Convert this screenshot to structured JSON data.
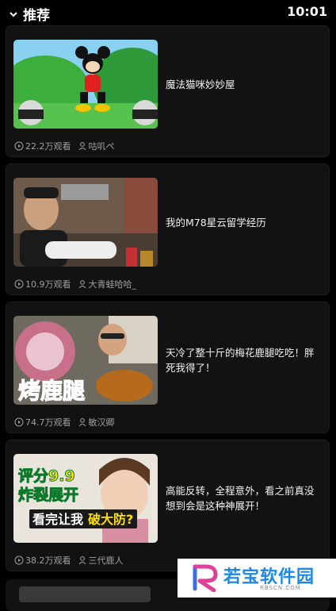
{
  "header": {
    "title": "推荐",
    "time": "10:01"
  },
  "videos": [
    {
      "title": "魔法猫咪妙妙屋",
      "views": "22.2万观看",
      "author": "咕叽ペ"
    },
    {
      "title": "我的M78星云留学经历",
      "views": "10.9万观看",
      "author": "大青蛙哈哈_"
    },
    {
      "title": "天冷了整十斤的梅花鹿腿吃吃！胖死我得了！",
      "views": "74.7万观看",
      "author": "敏汉卿",
      "thumb_text": "烤鹿腿"
    },
    {
      "title": "高能反转，全程意外，看之前真没想到会是这种神展开！",
      "views": "38.2万观看",
      "author": "三代鹿人",
      "thumb_text": [
        "评分9.9",
        "炸裂展开",
        "看完让我",
        "破大防?"
      ]
    }
  ],
  "watermark": {
    "text": "若宝软件园",
    "sub": "RBSCN.COM"
  }
}
